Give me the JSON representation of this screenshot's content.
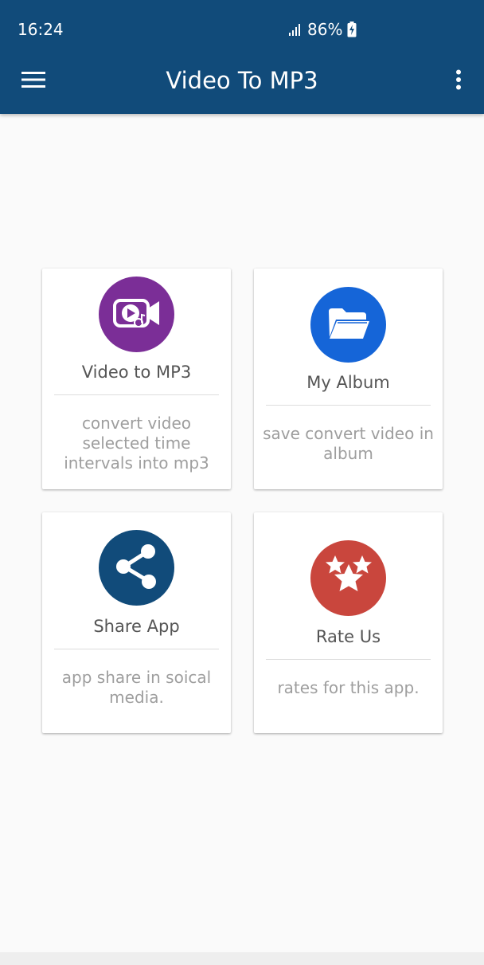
{
  "status_bar": {
    "time": "16:24",
    "battery": "86%"
  },
  "app_bar": {
    "title": "Video To MP3",
    "menu_icon": "hamburger-menu-icon",
    "more_icon": "more-vert-icon"
  },
  "cards": [
    {
      "title": "Video to MP3",
      "description": "convert video selected time intervals into mp3",
      "icon": "video-music-icon",
      "color": "#7b2e97"
    },
    {
      "title": "My Album",
      "description": "save convert video in album",
      "icon": "folder-open-icon",
      "color": "#1565d8"
    },
    {
      "title": "Share App",
      "description": "app share in soical media.",
      "icon": "share-icon",
      "color": "#114b7a"
    },
    {
      "title": "Rate Us",
      "description": "rates for this app.",
      "icon": "stars-icon",
      "color": "#c9463d"
    }
  ]
}
